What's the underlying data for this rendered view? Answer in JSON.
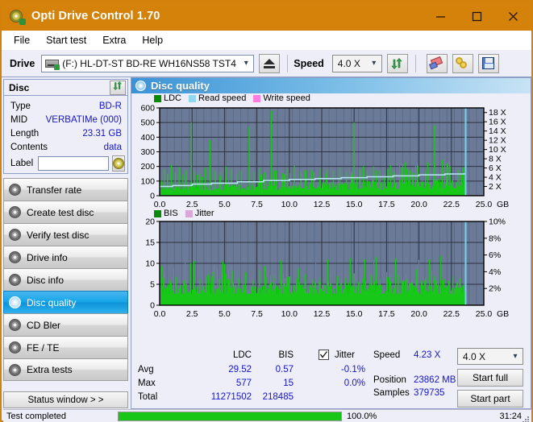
{
  "window": {
    "title": "Opti Drive Control 1.70",
    "icon": "disc-icon",
    "minimize": "minimize-icon",
    "maximize": "maximize-icon",
    "close": "close-icon"
  },
  "menu": {
    "items": [
      "File",
      "Start test",
      "Extra",
      "Help"
    ]
  },
  "toolbar": {
    "drive_label": "Drive",
    "drive_value": "(F:)  HL-DT-ST BD-RE  WH16NS58 TST4",
    "eject_icon": "eject-icon",
    "speed_label": "Speed",
    "speed_value": "4.0 X",
    "refresh_icon": "refresh-icon",
    "erase_icon": "eraser-icon",
    "link_icon": "link-icon",
    "save_icon": "save-icon"
  },
  "disc_panel": {
    "title": "Disc",
    "refresh_icon": "refresh-icon",
    "rows": [
      {
        "key": "Type",
        "value": "BD-R"
      },
      {
        "key": "MID",
        "value": "VERBATIMe (000)"
      },
      {
        "key": "Length",
        "value": "23.31 GB"
      },
      {
        "key": "Contents",
        "value": "data"
      }
    ],
    "label_key": "Label",
    "label_value": "",
    "label_placeholder": "",
    "label_button_icon": "disc-icon"
  },
  "nav": {
    "items": [
      {
        "label": "Transfer rate",
        "icon": "disc-icon",
        "active": false
      },
      {
        "label": "Create test disc",
        "icon": "disc-icon",
        "active": false
      },
      {
        "label": "Verify test disc",
        "icon": "disc-icon",
        "active": false
      },
      {
        "label": "Drive info",
        "icon": "disc-icon",
        "active": false
      },
      {
        "label": "Disc info",
        "icon": "disc-icon",
        "active": false
      },
      {
        "label": "Disc quality",
        "icon": "disc-icon",
        "active": true
      },
      {
        "label": "CD Bler",
        "icon": "disc-icon",
        "active": false
      },
      {
        "label": "FE / TE",
        "icon": "disc-icon",
        "active": false
      },
      {
        "label": "Extra tests",
        "icon": "disc-icon",
        "active": false
      }
    ],
    "status_window": "Status window > >"
  },
  "main": {
    "title": "Disc quality",
    "icon": "disc-icon"
  },
  "stats": {
    "col_ldc": "LDC",
    "col_bis": "BIS",
    "jitter_label": "Jitter",
    "jitter_checked": true,
    "rows": [
      {
        "label": "Avg",
        "ldc": "29.52",
        "bis": "0.57",
        "jitter": "-0.1%"
      },
      {
        "label": "Max",
        "ldc": "577",
        "bis": "15",
        "jitter": "0.0%"
      },
      {
        "label": "Total",
        "ldc": "11271502",
        "bis": "218485",
        "jitter": ""
      }
    ],
    "speed_label": "Speed",
    "speed_value": "4.23 X",
    "position_label": "Position",
    "position_value": "23862 MB",
    "samples_label": "Samples",
    "samples_value": "379735",
    "speed_select": "4.0 X",
    "start_full": "Start full",
    "start_part": "Start part"
  },
  "statusbar": {
    "text": "Test completed",
    "progress_pct": "100.0%",
    "progress_value": 100,
    "elapsed": "31:24"
  },
  "colors": {
    "titlebar": "#d5820b",
    "ldc_green": "#18c818",
    "read_speed": "#8fd8f0",
    "write_speed": "#ff7fe0",
    "bis_green": "#18c818",
    "jitter_pink": "#d9a8d9",
    "plot_bg": "#6b7a96",
    "accent_blue": "#1414c8"
  },
  "chart_data": [
    {
      "type": "line",
      "name": "quality-top-chart",
      "title": "",
      "xlabel": "GB",
      "ylabel": "",
      "xlim": [
        0.0,
        25.0
      ],
      "ylim": [
        0,
        600
      ],
      "xticks": [
        "0.0",
        "2.5",
        "5.0",
        "7.5",
        "10.0",
        "12.5",
        "15.0",
        "17.5",
        "20.0",
        "22.5",
        "25.0"
      ],
      "yticks": [
        "0",
        "100",
        "200",
        "300",
        "400",
        "500",
        "600"
      ],
      "y2ticks": [
        "2 X",
        "4 X",
        "6 X",
        "8 X",
        "10 X",
        "12 X",
        "14 X",
        "16 X",
        "18 X"
      ],
      "y2lim": [
        0,
        19
      ],
      "grid": true,
      "legend": [
        "LDC",
        "Read speed",
        "Write speed"
      ],
      "legend_position": "top-left",
      "data_end_x": 23.6,
      "series": [
        {
          "name": "LDC",
          "color": "#18c818",
          "kind": "spikes",
          "baseline": [
            60,
            62,
            63,
            65,
            66,
            68,
            70,
            71,
            73,
            75,
            77,
            79,
            82,
            85,
            88,
            92,
            96,
            100,
            104,
            108
          ],
          "spikes": [
            {
              "x": 0.35,
              "y": 180
            },
            {
              "x": 0.6,
              "y": 150
            },
            {
              "x": 0.9,
              "y": 210
            },
            {
              "x": 1.2,
              "y": 160
            },
            {
              "x": 1.5,
              "y": 195
            },
            {
              "x": 1.8,
              "y": 145
            },
            {
              "x": 2.05,
              "y": 175
            },
            {
              "x": 2.45,
              "y": 500
            },
            {
              "x": 2.7,
              "y": 165
            },
            {
              "x": 3.1,
              "y": 150
            },
            {
              "x": 3.5,
              "y": 190
            },
            {
              "x": 3.9,
              "y": 380
            },
            {
              "x": 4.3,
              "y": 170
            },
            {
              "x": 4.7,
              "y": 160
            },
            {
              "x": 5.1,
              "y": 200
            },
            {
              "x": 5.55,
              "y": 185
            },
            {
              "x": 5.95,
              "y": 155
            },
            {
              "x": 6.3,
              "y": 175
            },
            {
              "x": 6.9,
              "y": 470
            },
            {
              "x": 7.3,
              "y": 165
            },
            {
              "x": 7.7,
              "y": 190
            },
            {
              "x": 8.1,
              "y": 160
            },
            {
              "x": 8.6,
              "y": 580
            },
            {
              "x": 9.0,
              "y": 175
            },
            {
              "x": 9.5,
              "y": 155
            },
            {
              "x": 9.9,
              "y": 185
            },
            {
              "x": 10.4,
              "y": 205
            },
            {
              "x": 10.9,
              "y": 165
            },
            {
              "x": 11.3,
              "y": 175
            },
            {
              "x": 11.9,
              "y": 160
            },
            {
              "x": 12.4,
              "y": 190
            },
            {
              "x": 12.9,
              "y": 180
            },
            {
              "x": 13.4,
              "y": 170
            },
            {
              "x": 13.9,
              "y": 195
            },
            {
              "x": 14.4,
              "y": 165
            },
            {
              "x": 15.0,
              "y": 500
            },
            {
              "x": 15.5,
              "y": 180
            },
            {
              "x": 16.0,
              "y": 170
            },
            {
              "x": 16.5,
              "y": 200
            },
            {
              "x": 17.0,
              "y": 175
            },
            {
              "x": 17.6,
              "y": 185
            },
            {
              "x": 18.1,
              "y": 165
            },
            {
              "x": 18.7,
              "y": 195
            },
            {
              "x": 19.3,
              "y": 175
            },
            {
              "x": 19.9,
              "y": 185
            },
            {
              "x": 20.5,
              "y": 170
            },
            {
              "x": 21.2,
              "y": 480
            },
            {
              "x": 21.8,
              "y": 190
            },
            {
              "x": 22.4,
              "y": 200
            },
            {
              "x": 23.0,
              "y": 180
            },
            {
              "x": 23.4,
              "y": 195
            }
          ]
        },
        {
          "name": "Read speed",
          "color": "#b8e8f8",
          "kind": "step-line",
          "points": [
            {
              "x": 0.0,
              "y": 2.0
            },
            {
              "x": 1.0,
              "y": 2.2
            },
            {
              "x": 2.5,
              "y": 2.5
            },
            {
              "x": 4.0,
              "y": 2.7
            },
            {
              "x": 6.0,
              "y": 3.0
            },
            {
              "x": 8.0,
              "y": 3.3
            },
            {
              "x": 10.0,
              "y": 3.5
            },
            {
              "x": 12.0,
              "y": 3.7
            },
            {
              "x": 14.0,
              "y": 3.9
            },
            {
              "x": 16.0,
              "y": 4.1
            },
            {
              "x": 18.0,
              "y": 4.3
            },
            {
              "x": 20.0,
              "y": 4.5
            },
            {
              "x": 22.0,
              "y": 4.7
            },
            {
              "x": 23.5,
              "y": 4.9
            }
          ]
        },
        {
          "name": "Write speed",
          "color": "#ff7fe0",
          "kind": "none",
          "points": []
        }
      ]
    },
    {
      "type": "line",
      "name": "quality-bottom-chart",
      "title": "",
      "xlabel": "GB",
      "ylabel": "",
      "xlim": [
        0.0,
        25.0
      ],
      "ylim": [
        0,
        20
      ],
      "xticks": [
        "0.0",
        "2.5",
        "5.0",
        "7.5",
        "10.0",
        "12.5",
        "15.0",
        "17.5",
        "20.0",
        "22.5",
        "25.0"
      ],
      "yticks": [
        "0",
        "5",
        "10",
        "15",
        "20"
      ],
      "y2ticks": [
        "2%",
        "4%",
        "6%",
        "8%",
        "10%"
      ],
      "y2lim": [
        0,
        10
      ],
      "grid": true,
      "legend": [
        "BIS",
        "Jitter"
      ],
      "legend_position": "top-left",
      "data_end_x": 23.6,
      "series": [
        {
          "name": "BIS",
          "color": "#18c818",
          "kind": "spikes",
          "baseline": [
            4.4,
            4.5,
            4.5,
            4.6,
            4.6,
            4.6,
            4.7,
            4.7,
            4.7,
            4.8,
            4.8,
            4.8,
            4.9,
            4.9,
            4.9,
            5.0,
            5.0,
            5.0,
            5.0,
            5.0
          ],
          "spikes": [
            {
              "x": 0.3,
              "y": 6.5
            },
            {
              "x": 0.8,
              "y": 6.0
            },
            {
              "x": 1.3,
              "y": 6.8
            },
            {
              "x": 1.9,
              "y": 5.9
            },
            {
              "x": 2.4,
              "y": 10.0
            },
            {
              "x": 2.6,
              "y": 9.5
            },
            {
              "x": 3.1,
              "y": 6.2
            },
            {
              "x": 3.6,
              "y": 7.0
            },
            {
              "x": 4.1,
              "y": 8.0
            },
            {
              "x": 4.6,
              "y": 6.3
            },
            {
              "x": 5.1,
              "y": 7.5
            },
            {
              "x": 5.6,
              "y": 8.2
            },
            {
              "x": 6.1,
              "y": 6.4
            },
            {
              "x": 6.6,
              "y": 7.1
            },
            {
              "x": 7.2,
              "y": 6.0
            },
            {
              "x": 7.7,
              "y": 8.4
            },
            {
              "x": 8.2,
              "y": 6.6
            },
            {
              "x": 8.8,
              "y": 7.2
            },
            {
              "x": 9.4,
              "y": 6.1
            },
            {
              "x": 10.0,
              "y": 6.9
            },
            {
              "x": 10.6,
              "y": 6.3
            },
            {
              "x": 11.2,
              "y": 7.4
            },
            {
              "x": 11.8,
              "y": 6.2
            },
            {
              "x": 12.4,
              "y": 6.8
            },
            {
              "x": 13.0,
              "y": 6.0
            },
            {
              "x": 13.7,
              "y": 7.0
            },
            {
              "x": 14.3,
              "y": 6.5
            },
            {
              "x": 15.0,
              "y": 7.6
            },
            {
              "x": 15.7,
              "y": 6.4
            },
            {
              "x": 16.3,
              "y": 7.2
            },
            {
              "x": 17.0,
              "y": 6.1
            },
            {
              "x": 17.7,
              "y": 6.8
            },
            {
              "x": 18.4,
              "y": 7.3
            },
            {
              "x": 19.1,
              "y": 6.2
            },
            {
              "x": 19.8,
              "y": 8.5
            },
            {
              "x": 20.5,
              "y": 6.6
            },
            {
              "x": 21.2,
              "y": 7.0
            },
            {
              "x": 21.9,
              "y": 6.3
            },
            {
              "x": 22.6,
              "y": 6.9
            },
            {
              "x": 23.2,
              "y": 6.5
            }
          ]
        },
        {
          "name": "Jitter",
          "color": "#d9a8d9",
          "kind": "none",
          "points": []
        }
      ]
    }
  ]
}
